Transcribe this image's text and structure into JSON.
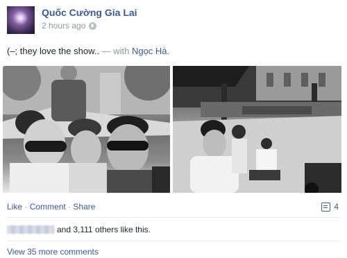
{
  "post": {
    "author": "Quốc Cường Gia Lai",
    "time": "2 hours ago",
    "privacy_icon": "globe-icon",
    "caption": "(–; they love the show..",
    "with_label": "— with",
    "tagged": "Ngọc Hà."
  },
  "actions": {
    "like": "Like",
    "comment": "Comment",
    "share": "Share",
    "separator": "·",
    "comment_count": "4"
  },
  "likes": {
    "text": "and 3,111 others like this."
  },
  "comments": {
    "view_more": "View 35 more comments"
  },
  "colors": {
    "link": "#3b5998",
    "meta": "#90949c"
  }
}
